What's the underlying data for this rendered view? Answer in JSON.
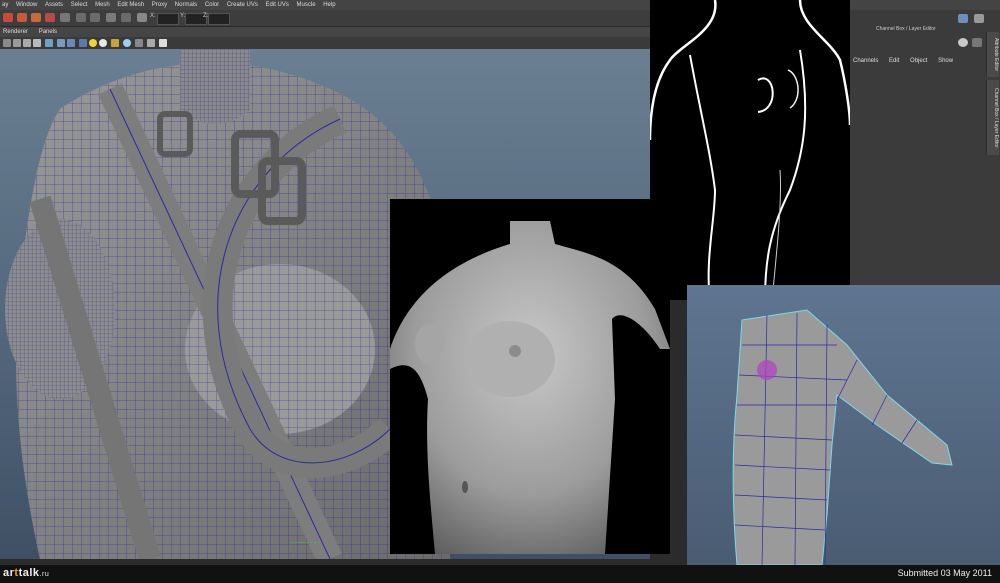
{
  "menubar": {
    "items": [
      "ay",
      "Window",
      "Assets",
      "Select",
      "Mesh",
      "Edit Mesh",
      "Proxy",
      "Normals",
      "Color",
      "Create UVs",
      "Edit UVs",
      "Muscle",
      "Help"
    ]
  },
  "statusline": {
    "x_label": "X:",
    "y_label": "Y:",
    "z_label": "Z:"
  },
  "panel_menu": {
    "items": [
      "Renderer",
      "Panels"
    ]
  },
  "right_panel": {
    "title": "Channel Box / Layer Editor",
    "menu": [
      "Channels",
      "Edit",
      "Object",
      "Show"
    ],
    "side_tabs": [
      "Attribute Editor",
      "Channel Box / Layer Editor"
    ]
  },
  "footer": {
    "logo_prefix": "ar",
    "logo_dot": "t",
    "logo_name": "talk",
    "logo_tld": ".ru",
    "submitted": "Submitted 03 May 2011"
  },
  "colors": {
    "maya_bg": "#3b3b3b",
    "viewport_top": "#6b7f93",
    "viewport_bottom": "#3f5064",
    "wire_blue": "#2a2aa0",
    "accent_orange": "#f39a1d"
  }
}
